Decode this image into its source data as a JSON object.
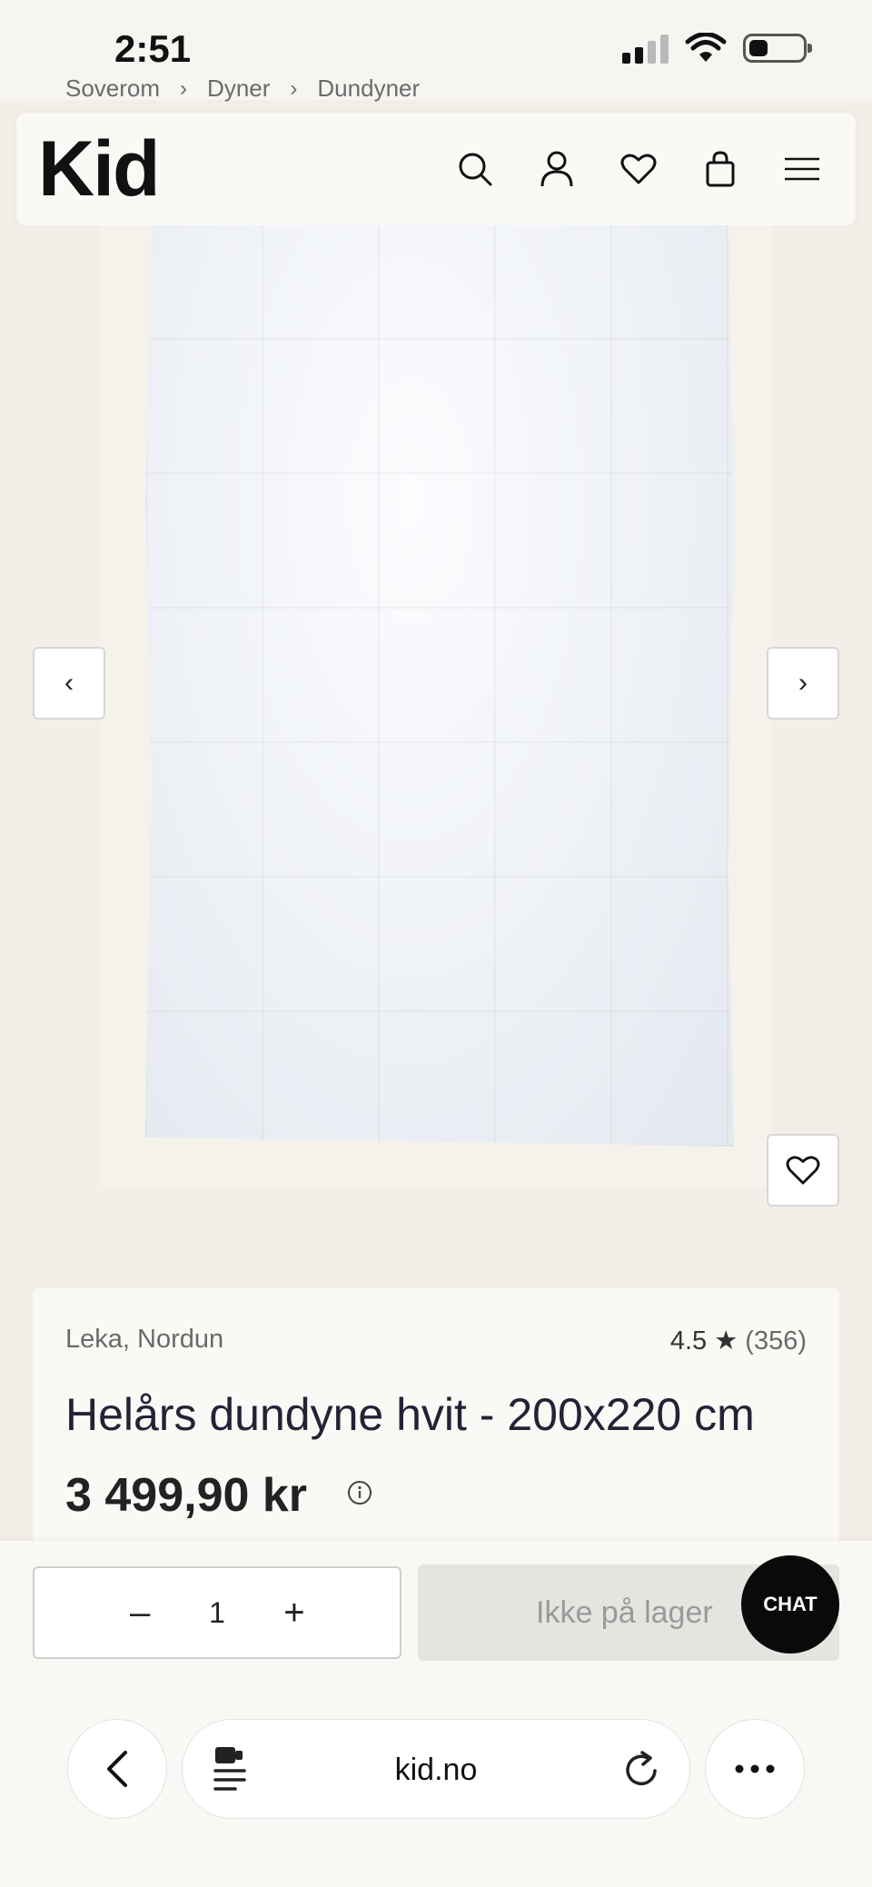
{
  "status_bar": {
    "time": "2:51",
    "battery_level": 0.3,
    "signal_bars": 2
  },
  "breadcrumb": {
    "items": [
      "Soverom",
      "Dyner",
      "Dundyner"
    ],
    "separator": "›"
  },
  "header": {
    "logo": "Kid",
    "icons": [
      "search-icon",
      "account-icon",
      "wishlist-heart-icon",
      "shopping-bag-icon",
      "menu-icon"
    ]
  },
  "gallery": {
    "prev_label": "‹",
    "next_label": "›",
    "favorite_icon": "heart-icon"
  },
  "product": {
    "brand": "Leka, Nordun",
    "rating": "4.5",
    "rating_star": "★",
    "rating_count": "(356)",
    "title": "Helårs dundyne hvit - 200x220 cm",
    "price": "3 499,90 kr"
  },
  "purchase": {
    "decrement": "–",
    "quantity": "1",
    "increment": "+",
    "stock_label": "Ikke på lager",
    "chat_label": "CHAT"
  },
  "browser": {
    "url": "kid.no"
  },
  "colors": {
    "background": "#f3efe8",
    "card": "#faf9f6",
    "chat": "#0a0a0a",
    "disabled": "#e6e4e1"
  }
}
